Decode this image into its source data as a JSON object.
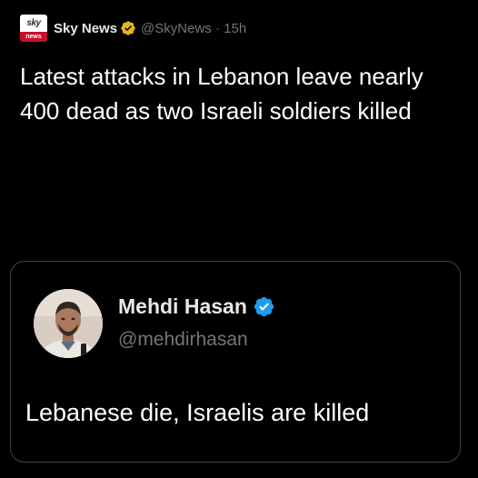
{
  "tweet": {
    "logo": {
      "top_text": "sky",
      "bottom_text": "news"
    },
    "author_name": "Sky News",
    "verified_badge": "verified-gold-icon",
    "handle": "@SkyNews",
    "separator": "·",
    "time": "15h",
    "text": "Latest attacks in Lebanon leave nearly 400 dead as two Israeli soldiers killed"
  },
  "quote": {
    "author_name": "Mehdi Hasan",
    "verified_badge": "verified-blue-icon",
    "handle": "@mehdirhasan",
    "text": "Lebanese die, Israelis are killed",
    "avatar": "avatar-photo"
  },
  "colors": {
    "background": "#000000",
    "text_primary": "#e7e9ea",
    "text_secondary": "#71767b",
    "card_border": "#3f4448",
    "verified_blue": "#1d9bf0",
    "verified_gold": "#e2b719",
    "sky_red": "#c8102e"
  }
}
